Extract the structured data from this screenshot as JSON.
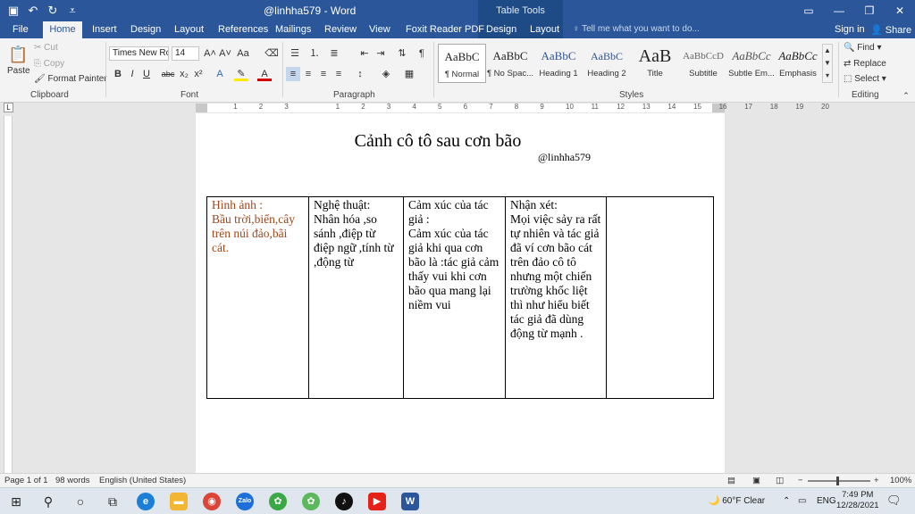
{
  "titlebar": {
    "doc_title": "@linhha579 - Word",
    "table_tools": "Table Tools"
  },
  "tabs": [
    {
      "label": "File"
    },
    {
      "label": "Home"
    },
    {
      "label": "Insert"
    },
    {
      "label": "Design"
    },
    {
      "label": "Layout"
    },
    {
      "label": "References"
    },
    {
      "label": "Mailings"
    },
    {
      "label": "Review"
    },
    {
      "label": "View"
    },
    {
      "label": "Foxit Reader PDF"
    },
    {
      "label": "Design"
    },
    {
      "label": "Layout"
    }
  ],
  "tell_me": "Tell me what you want to do...",
  "sign_in": "Sign in",
  "share": "Share",
  "clipboard": {
    "paste": "Paste",
    "cut": "Cut",
    "copy": "Copy",
    "format_painter": "Format Painter",
    "label": "Clipboard"
  },
  "font": {
    "name": "Times New Ro",
    "size": "14",
    "label": "Font"
  },
  "paragraph": {
    "label": "Paragraph"
  },
  "styles": {
    "label": "Styles",
    "items": [
      {
        "sample": "AaBbC",
        "name": "¶ Normal"
      },
      {
        "sample": "AaBbC",
        "name": "¶ No Spac..."
      },
      {
        "sample": "AaBbC",
        "name": "Heading 1"
      },
      {
        "sample": "AaBbC",
        "name": "Heading 2"
      },
      {
        "sample": "AaB",
        "name": "Title"
      },
      {
        "sample": "AaBbCcD",
        "name": "Subtitle"
      },
      {
        "sample": "AaBbCc",
        "name": "Subtle Em..."
      },
      {
        "sample": "AaBbCc",
        "name": "Emphasis"
      }
    ]
  },
  "editing": {
    "find": "Find",
    "replace": "Replace",
    "select": "Select",
    "label": "Editing"
  },
  "ruler": {
    "numbers": [
      "1",
      "2",
      "3",
      "1",
      "2",
      "3",
      "4",
      "5",
      "6",
      "7",
      "8",
      "9",
      "10",
      "11",
      "12",
      "13",
      "14",
      "15",
      "16",
      "17",
      "18",
      "19",
      "20"
    ]
  },
  "document": {
    "title": "Cảnh cô tô sau cơn bão",
    "author": "@linhha579",
    "table": {
      "cells": [
        "Hình ảnh :\nBầu trời,biển,cây trên núi đảo,bãi cát.",
        "Nghệ thuật:\nNhân hóa ,so sánh ,điệp từ điệp ngữ ,tính từ ,động từ",
        "Cảm xúc của tác giả :\nCảm xúc của tác giả khi qua cơn bão là :tác giả cảm thấy vui khi cơn bão qua mang lại niềm vui",
        "Nhận xét:\nMọi việc sảy ra rất tự nhiên và tác giả đã ví cơn bão cát trên đảo cô tô nhưng một chiến trường khốc liệt thì như hiểu biết tác giả đã dùng động từ mạnh .",
        ""
      ]
    }
  },
  "statusbar": {
    "page": "Page 1 of 1",
    "words": "98 words",
    "language": "English (United States)",
    "zoom": "100%"
  },
  "taskbar": {
    "weather": "60°F  Clear",
    "lang": "ENG",
    "time": "7:49 PM",
    "date": "12/28/2021"
  },
  "colors": {
    "word_blue": "#2b579a",
    "ribbon_bg": "#f3f3f3",
    "cell1_text": "#a0461a"
  }
}
